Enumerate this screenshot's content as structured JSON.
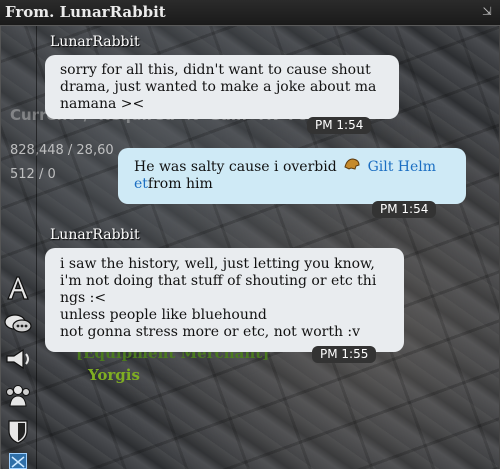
{
  "window": {
    "title": "From. LunarRabbit",
    "resize_glyph": "⇲"
  },
  "background": {
    "header": "Current / Required  %      Gain  TN  For...",
    "row1": "828,448 / 28,60",
    "row2": "512 / 0",
    "npc_title": "[Equipment Merchant]",
    "npc_name": "Yorgis"
  },
  "messages": [
    {
      "sender": "LunarRabbit",
      "lines": [
        "sorry for all this, didn't want to cause shout",
        "drama, just wanted to make a joke about ma",
        "namana ><"
      ],
      "time": "PM 1:54"
    },
    {
      "text_before": "He was salty cause i overbid",
      "item_name_part1": "Gilt Helm",
      "item_name_part2": "et",
      "text_after": "from him",
      "time": "PM 1:54"
    },
    {
      "sender": "LunarRabbit",
      "lines": [
        "i saw the history, well, just letting you know,",
        "i'm not doing that stuff of shouting or etc thi",
        "ngs :<",
        "unless people like bluehound",
        "not gonna stress more or etc, not worth :v"
      ],
      "time": "PM 1:55"
    }
  ],
  "side_icons": [
    "text-size-icon",
    "chat-bubbles-icon",
    "megaphone-icon",
    "group-icon",
    "guild-shield-icon"
  ],
  "colors": {
    "incoming_bubble": "#e9ecef",
    "outgoing_bubble": "#cfeaf6",
    "item_link": "#1b6ec2",
    "npc_title": "#4b7a1f",
    "npc_name": "#7fae22"
  }
}
